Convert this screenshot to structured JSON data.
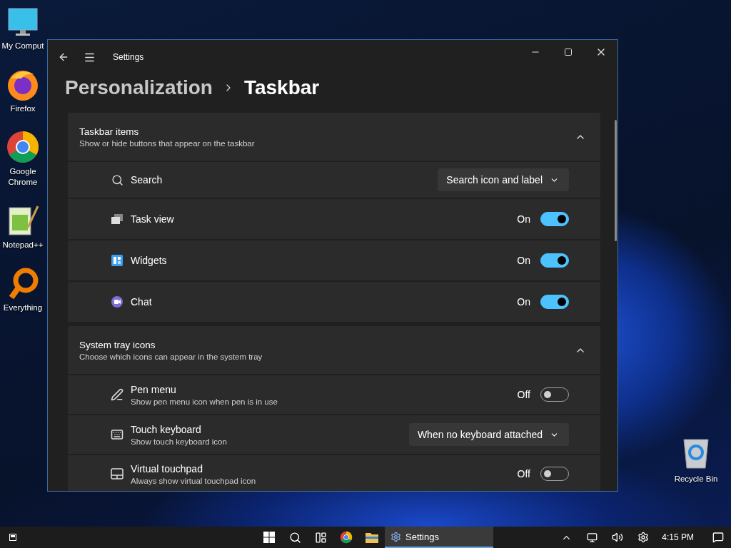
{
  "desktop_icons": [
    {
      "label": "My Comput",
      "kind": "computer"
    },
    {
      "label": "Firefox",
      "kind": "firefox"
    },
    {
      "label": "Google Chrome",
      "kind": "chrome"
    },
    {
      "label": "Notepad++",
      "kind": "notepad"
    },
    {
      "label": "Everything",
      "kind": "everything"
    }
  ],
  "recycle_bin": {
    "label": "Recycle Bin"
  },
  "window": {
    "title": "Settings"
  },
  "breadcrumb": {
    "parent": "Personalization",
    "current": "Taskbar"
  },
  "sections": [
    {
      "title": "Taskbar items",
      "subtitle": "Show or hide buttons that appear on the taskbar",
      "expanded": true,
      "rows": [
        {
          "kind": "dropdown",
          "label": "Search",
          "value": "Search icon and label"
        },
        {
          "kind": "toggle",
          "label": "Task view",
          "on": true,
          "state_label": "On"
        },
        {
          "kind": "toggle",
          "label": "Widgets",
          "on": true,
          "state_label": "On"
        },
        {
          "kind": "toggle",
          "label": "Chat",
          "on": true,
          "state_label": "On"
        }
      ]
    },
    {
      "title": "System tray icons",
      "subtitle": "Choose which icons can appear in the system tray",
      "expanded": true,
      "rows": [
        {
          "kind": "toggle",
          "label": "Pen menu",
          "description": "Show pen menu icon when pen is in use",
          "on": false,
          "state_label": "Off"
        },
        {
          "kind": "dropdown",
          "label": "Touch keyboard",
          "description": "Show touch keyboard icon",
          "value": "When no keyboard attached"
        },
        {
          "kind": "toggle",
          "label": "Virtual touchpad",
          "description": "Always show virtual touchpad icon",
          "on": false,
          "state_label": "Off"
        }
      ]
    }
  ],
  "taskbar": {
    "apps": [
      {
        "kind": "settings",
        "label": "Settings",
        "selected": true
      }
    ],
    "time": "4:15 PM"
  }
}
